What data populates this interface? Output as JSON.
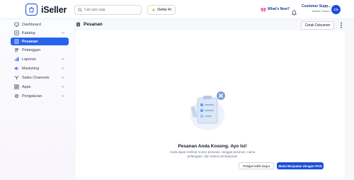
{
  "app": {
    "name": "iSeller"
  },
  "search": {
    "placeholder": "Cari apa saja"
  },
  "ai_button": {
    "label": "iSeller AI"
  },
  "header": {
    "whats_new": "What's New?",
    "user_name": "Customer Supp...",
    "user_subtitle": "Mobile Pasien",
    "avatar_initials": "CS"
  },
  "sidebar": {
    "items": [
      {
        "label": "Dashboard",
        "icon": "monitor-icon",
        "expandable": false,
        "active": false
      },
      {
        "label": "Katalog",
        "icon": "catalog-icon",
        "expandable": true,
        "active": false
      },
      {
        "label": "Pesanan",
        "icon": "orders-icon",
        "expandable": false,
        "active": true
      },
      {
        "label": "Pelanggan",
        "icon": "customers-icon",
        "expandable": false,
        "active": false
      },
      {
        "label": "Laporan",
        "icon": "chart-icon",
        "expandable": true,
        "active": false
      },
      {
        "label": "Marketing",
        "icon": "megaphone-icon",
        "expandable": true,
        "active": false
      },
      {
        "label": "Sales Channels",
        "icon": "channels-icon",
        "expandable": true,
        "active": false
      },
      {
        "label": "Apps",
        "icon": "apps-icon",
        "expandable": true,
        "active": false
      },
      {
        "label": "Pengaturan",
        "icon": "gear-icon",
        "expandable": true,
        "active": false
      }
    ]
  },
  "page": {
    "title": "Pesanan",
    "print_button": "Cetak Dokumen"
  },
  "empty_state": {
    "title": "Pesanan Anda Kosong. Ayo Isi!",
    "description": "Anda dapat melihat nomor pesanan, tanggal pesanan, nama pelanggan, dan status pembayaran",
    "secondary_button": "Pelajari lebih lanjut",
    "primary_button": "Mulai Berjualan dengan POS"
  },
  "colors": {
    "accent": "#2563eb",
    "primary_button": "#1d4ed8",
    "brand_text": "#1e3a8a"
  }
}
